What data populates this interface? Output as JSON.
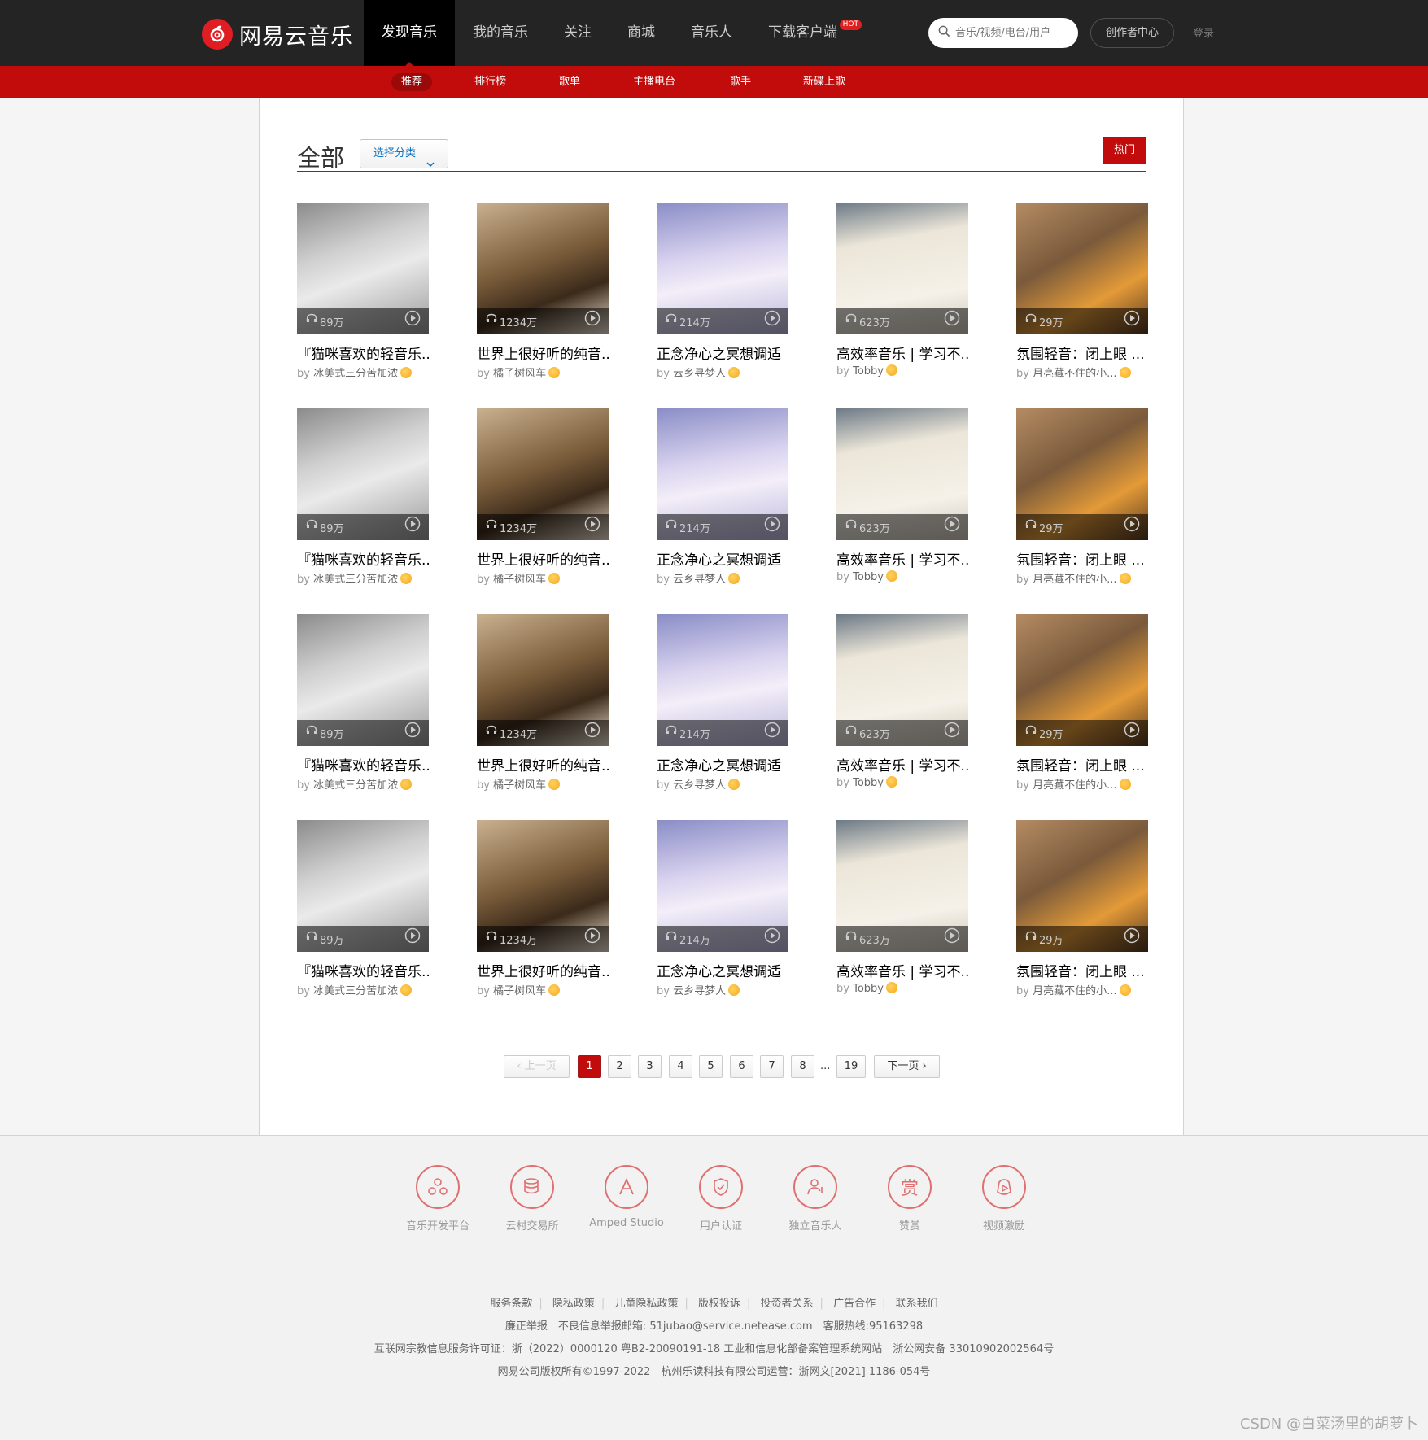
{
  "brand": {
    "name": "网易云音乐"
  },
  "nav": {
    "items": [
      "发现音乐",
      "我的音乐",
      "关注",
      "商城",
      "音乐人",
      "下载客户端"
    ],
    "hot_badge": "HOT",
    "search_placeholder": "音乐/视频/电台/用户",
    "creator": "创作者中心",
    "login": "登录"
  },
  "subnav": {
    "items": [
      "推荐",
      "排行榜",
      "歌单",
      "主播电台",
      "歌手",
      "新碟上歌"
    ]
  },
  "main": {
    "title": "全部",
    "category_button": "选择分类",
    "hot_button": "热门"
  },
  "playlists": [
    {
      "title": "『猫咪喜欢的轻音乐...",
      "by": "by",
      "author": "冰美式三分苦加浓",
      "count": "89万",
      "art": "cat"
    },
    {
      "title": "世界上很好听的纯音...",
      "by": "by",
      "author": "橘子树风车",
      "count": "1234万",
      "art": "piano"
    },
    {
      "title": "正念净心之冥想调适",
      "by": "by",
      "author": "云乡寻梦人",
      "count": "214万",
      "art": "mind"
    },
    {
      "title": "高效率音乐 | 学习不...",
      "by": "by",
      "author": "Tobby",
      "count": "623万",
      "art": "note"
    },
    {
      "title": "氛围轻音：闭上眼 ...",
      "by": "by",
      "author": "月亮藏不住的小...",
      "count": "29万",
      "art": "room"
    },
    {
      "title": "『猫咪喜欢的轻音乐...",
      "by": "by",
      "author": "冰美式三分苦加浓",
      "count": "89万",
      "art": "cat"
    },
    {
      "title": "世界上很好听的纯音...",
      "by": "by",
      "author": "橘子树风车",
      "count": "1234万",
      "art": "piano"
    },
    {
      "title": "正念净心之冥想调适",
      "by": "by",
      "author": "云乡寻梦人",
      "count": "214万",
      "art": "mind"
    },
    {
      "title": "高效率音乐 | 学习不...",
      "by": "by",
      "author": "Tobby",
      "count": "623万",
      "art": "note"
    },
    {
      "title": "氛围轻音：闭上眼 ...",
      "by": "by",
      "author": "月亮藏不住的小...",
      "count": "29万",
      "art": "room"
    },
    {
      "title": "『猫咪喜欢的轻音乐...",
      "by": "by",
      "author": "冰美式三分苦加浓",
      "count": "89万",
      "art": "cat"
    },
    {
      "title": "世界上很好听的纯音...",
      "by": "by",
      "author": "橘子树风车",
      "count": "1234万",
      "art": "piano"
    },
    {
      "title": "正念净心之冥想调适",
      "by": "by",
      "author": "云乡寻梦人",
      "count": "214万",
      "art": "mind"
    },
    {
      "title": "高效率音乐 | 学习不...",
      "by": "by",
      "author": "Tobby",
      "count": "623万",
      "art": "note"
    },
    {
      "title": "氛围轻音：闭上眼 ...",
      "by": "by",
      "author": "月亮藏不住的小...",
      "count": "29万",
      "art": "room"
    },
    {
      "title": "『猫咪喜欢的轻音乐...",
      "by": "by",
      "author": "冰美式三分苦加浓",
      "count": "89万",
      "art": "cat"
    },
    {
      "title": "世界上很好听的纯音...",
      "by": "by",
      "author": "橘子树风车",
      "count": "1234万",
      "art": "piano"
    },
    {
      "title": "正念净心之冥想调适",
      "by": "by",
      "author": "云乡寻梦人",
      "count": "214万",
      "art": "mind"
    },
    {
      "title": "高效率音乐 | 学习不...",
      "by": "by",
      "author": "Tobby",
      "count": "623万",
      "art": "note"
    },
    {
      "title": "氛围轻音：闭上眼 ...",
      "by": "by",
      "author": "月亮藏不住的小...",
      "count": "29万",
      "art": "room"
    }
  ],
  "pagination": {
    "prev": "上一页",
    "next": "下一页",
    "pages": [
      "1",
      "2",
      "3",
      "4",
      "5",
      "6",
      "7",
      "8"
    ],
    "ellipsis": "...",
    "last": "19",
    "current": "1"
  },
  "footer": {
    "services": [
      "音乐开发平台",
      "云村交易所",
      "Amped Studio",
      "用户认证",
      "独立音乐人",
      "赞赏",
      "视频激励"
    ],
    "links": [
      "服务条款",
      "隐私政策",
      "儿童隐私政策",
      "版权投诉",
      "投资者关系",
      "广告合作",
      "联系我们"
    ],
    "line2": "廉正举报　不良信息举报邮箱: 51jubao@service.netease.com　客服热线:95163298",
    "line3": "互联网宗教信息服务许可证：浙（2022）0000120 粤B2-20090191-18 工业和信息化部备案管理系统网站　浙公网安备 33010902002564号",
    "line4": "网易公司版权所有©1997-2022　杭州乐读科技有限公司运营：浙网文[2021] 1186-054号"
  },
  "watermark": "CSDN @白菜汤里的胡萝卜",
  "colors": {
    "brand_red": "#c20c0c",
    "topbar": "#242424"
  }
}
